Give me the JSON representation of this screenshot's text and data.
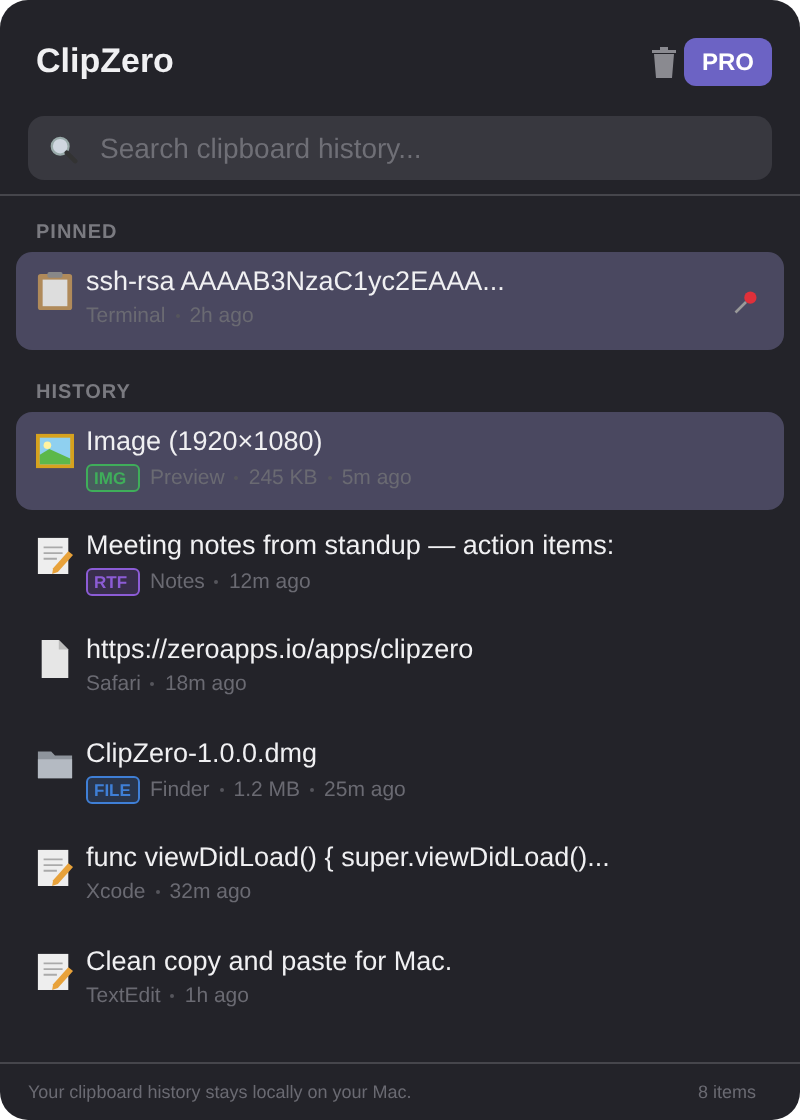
{
  "header": {
    "title": "ClipZero",
    "badge": "PRO"
  },
  "search": {
    "placeholder": "Search clipboard history..."
  },
  "sections": [
    {
      "label": "PINNED",
      "items": [
        {
          "kind": "clipboard",
          "title": "ssh-rsa AAAAB3NzaC1yc2EAAA...",
          "app": "Terminal",
          "time": "2h ago",
          "pinned": true,
          "selected": true
        }
      ]
    },
    {
      "label": "HISTORY",
      "items": [
        {
          "kind": "image",
          "title": "Image (1920×1080)",
          "tag": "IMG",
          "color": "#3fae5a",
          "app": "Preview",
          "size": "245 KB",
          "time": "5m ago",
          "selected": true
        },
        {
          "kind": "note",
          "title": "Meeting notes from standup — action items:",
          "tag": "RTF",
          "color": "#8c5cd6",
          "app": "Notes",
          "time": "12m ago",
          "selected": false
        },
        {
          "kind": "doc",
          "title": "https://zeroapps.io/apps/clipzero",
          "app": "Safari",
          "time": "18m ago",
          "selected": false
        },
        {
          "kind": "folder",
          "title": "ClipZero-1.0.0.dmg",
          "tag": "FILE",
          "color": "#3f7fd6",
          "app": "Finder",
          "size": "1.2 MB",
          "time": "25m ago",
          "selected": false
        },
        {
          "kind": "note",
          "title": "func viewDidLoad() { super.viewDidLoad()...",
          "app": "Xcode",
          "time": "32m ago",
          "selected": false
        },
        {
          "kind": "note",
          "title": "Clean copy and paste for Mac.",
          "app": "TextEdit",
          "time": "1h ago",
          "selected": false
        }
      ]
    }
  ],
  "footer": {
    "note": "Your clipboard history stays locally on your Mac.",
    "count": "8 items"
  }
}
